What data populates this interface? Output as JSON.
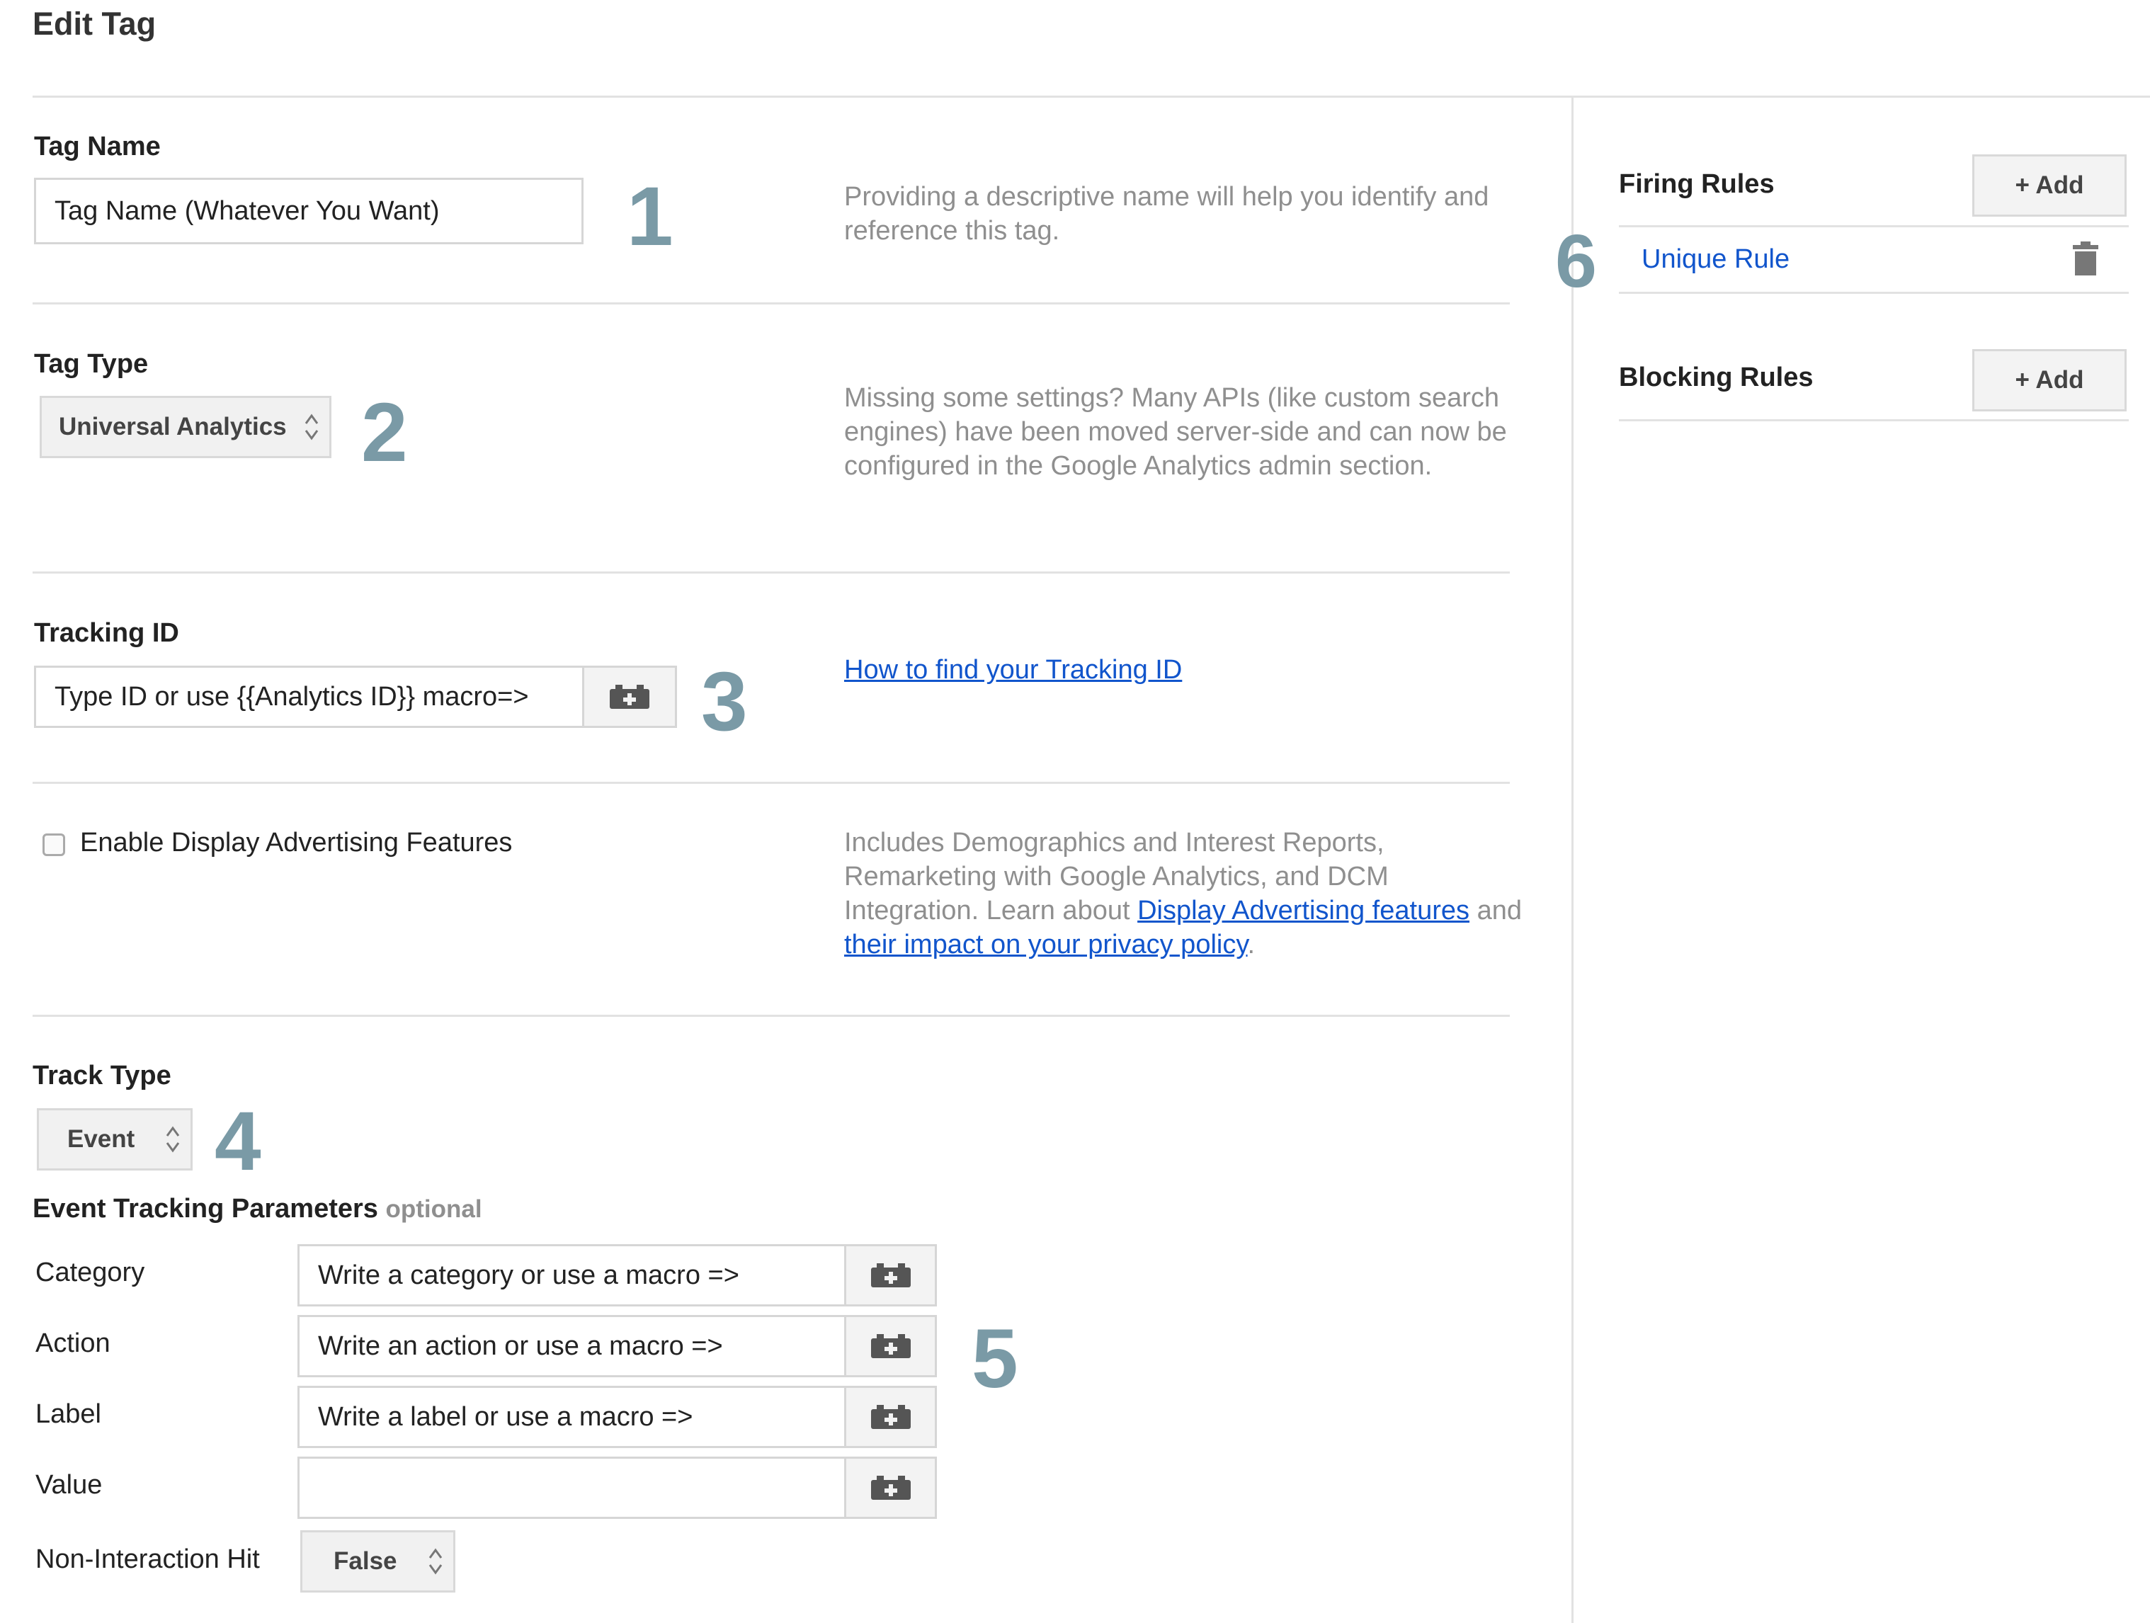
{
  "header": {
    "title": "Edit Tag"
  },
  "tag_name": {
    "label": "Tag Name",
    "value": "Tag Name (Whatever You Want)",
    "step": "1",
    "help": "Providing a descriptive name will help you identify and reference this tag."
  },
  "tag_type": {
    "label": "Tag Type",
    "selected": "Universal Analytics",
    "step": "2",
    "help": "Missing some settings? Many APIs (like custom search engines) have been moved server-side and can now be configured in the Google Analytics admin section."
  },
  "tracking_id": {
    "label": "Tracking ID",
    "value": "Type ID or use {{Analytics ID}} macro=>",
    "step": "3",
    "help_link": "How to find your Tracking ID"
  },
  "display_ads": {
    "checkbox_label": "Enable Display Advertising Features",
    "checked": false,
    "help_text_1": "Includes Demographics and Interest Reports, Remarketing with Google Analytics, and DCM Integration. Learn about",
    "help_link_1": "Display Advertising features",
    "help_text_2": "and",
    "help_link_2": "their impact on your privacy policy",
    "help_text_3": "."
  },
  "track_type": {
    "label": "Track Type",
    "selected": "Event",
    "step": "4"
  },
  "event_params": {
    "title": "Event Tracking Parameters",
    "optional": "optional",
    "step": "5",
    "category": {
      "label": "Category",
      "value": "Write a category or use a macro =>"
    },
    "action": {
      "label": "Action",
      "value": "Write an action or use a macro =>"
    },
    "label_field": {
      "label": "Label",
      "value": "Write a label or use a macro =>"
    },
    "value_field": {
      "label": "Value",
      "value": ""
    },
    "non_interaction": {
      "label": "Non-Interaction Hit",
      "selected": "False"
    }
  },
  "rules": {
    "step": "6",
    "firing_title": "Firing Rules",
    "add_label": "+ Add",
    "firing_items": [
      "Unique Rule"
    ],
    "blocking_title": "Blocking Rules"
  },
  "colors": {
    "step_number": "#7a9aa6",
    "link": "#1155cc",
    "help_text": "#8f8f8f",
    "divider": "#e2e2e2"
  },
  "icons": {
    "macro": "lego-brick-plus-icon",
    "select": "up-down-chevron-icon",
    "delete": "trash-icon",
    "checkbox": "checkbox-unchecked"
  }
}
